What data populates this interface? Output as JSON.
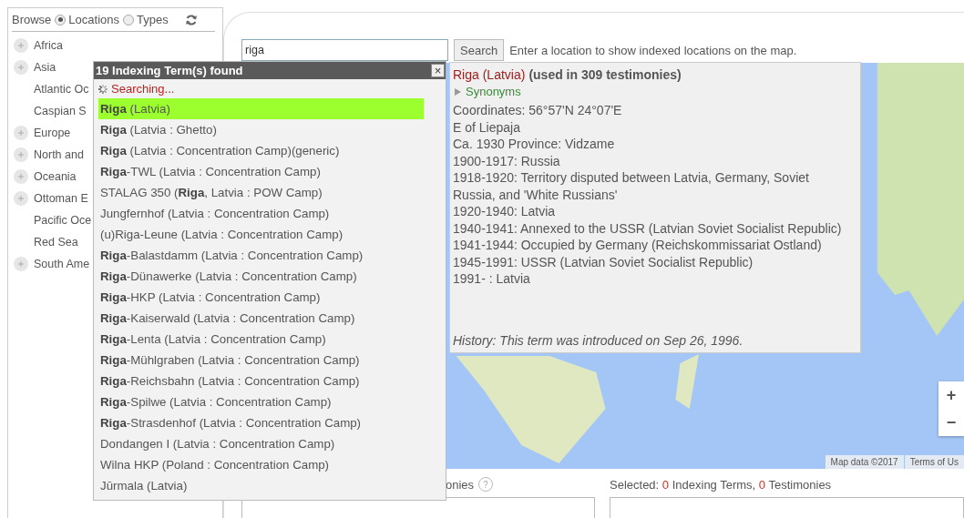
{
  "sidebar": {
    "browse_label": "Browse",
    "options": [
      {
        "label": "Locations",
        "selected": true
      },
      {
        "label": "Types",
        "selected": false
      }
    ],
    "tree": [
      {
        "label": "Africa",
        "expandable": true
      },
      {
        "label": "Asia",
        "expandable": true
      },
      {
        "label": "Atlantic Oc",
        "expandable": false
      },
      {
        "label": "Caspian S",
        "expandable": false
      },
      {
        "label": "Europe",
        "expandable": true
      },
      {
        "label": "North and",
        "expandable": true
      },
      {
        "label": "Oceania",
        "expandable": true
      },
      {
        "label": "Ottoman E",
        "expandable": true
      },
      {
        "label": "Pacific Oce",
        "expandable": false
      },
      {
        "label": "Red Sea",
        "expandable": false
      },
      {
        "label": "South Ame",
        "expandable": true
      }
    ]
  },
  "search": {
    "value": "riga",
    "button": "Search",
    "hint": "Enter a location to show indexed locations on the map."
  },
  "results": {
    "title": "19 Indexing Term(s) found",
    "close": "×",
    "status": "Searching...",
    "items": [
      {
        "text": "**Riga** (Latvia)",
        "selected": true
      },
      {
        "text": "**Riga** (Latvia : Ghetto)",
        "selected": false
      },
      {
        "text": "**Riga** (Latvia : Concentration Camp)(generic)",
        "selected": false
      },
      {
        "text": "**Riga**-TWL (Latvia : Concentration Camp)",
        "selected": false
      },
      {
        "text": "STALAG 350 (**Riga**, Latvia : POW Camp)",
        "selected": false
      },
      {
        "text": "Jungfernhof (Latvia : Concentration Camp)",
        "selected": false
      },
      {
        "text": "(u)Riga-Leune (Latvia : Concentration Camp)",
        "selected": false
      },
      {
        "text": "**Riga**-Balastdamm (Latvia : Concentration Camp)",
        "selected": false
      },
      {
        "text": "**Riga**-Dünawerke (Latvia : Concentration Camp)",
        "selected": false
      },
      {
        "text": "**Riga**-HKP (Latvia : Concentration Camp)",
        "selected": false
      },
      {
        "text": "**Riga**-Kaiserwald (Latvia : Concentration Camp)",
        "selected": false
      },
      {
        "text": "**Riga**-Lenta (Latvia : Concentration Camp)",
        "selected": false
      },
      {
        "text": "**Riga**-Mühlgraben (Latvia : Concentration Camp)",
        "selected": false
      },
      {
        "text": "**Riga**-Reichsbahn (Latvia : Concentration Camp)",
        "selected": false
      },
      {
        "text": "**Riga**-Spilwe (Latvia : Concentration Camp)",
        "selected": false
      },
      {
        "text": "**Riga**-Strasdenhof (Latvia : Concentration Camp)",
        "selected": false
      },
      {
        "text": "Dondangen I (Latvia : Concentration Camp)",
        "selected": false
      },
      {
        "text": "Wilna HKP (Poland : Concentration Camp)",
        "selected": false
      },
      {
        "text": "Jūrmala (Latvia)",
        "selected": false
      }
    ]
  },
  "details": {
    "term": "Riga (Latvia)",
    "usage": "(used in 309 testimonies)",
    "synonyms": "Synonyms",
    "expanded": false,
    "lines": [
      "Coordinates: 56°57'N 24°07'E",
      "E of Liepaja",
      "Ca. 1930 Province: Vidzame",
      "1900-1917: Russia",
      "1918-1920: Territory disputed between Latvia, Germany, Soviet Russia, and 'White Russians'",
      "1920-1940: Latvia",
      "1940-1941: Annexed to the USSR (Latvian Soviet Socialist Republic)",
      "1941-1944: Occupied by Germany (Reichskommissariat Ostland)",
      "1945-1991: USSR (Latvian Soviet Socialist Republic)",
      "1991- : Latvia"
    ],
    "history": "History: This term was introduced on Sep 26, 1996."
  },
  "map": {
    "zoom_in": "+",
    "zoom_out": "−",
    "attribution": "Map data ©2017",
    "terms": "Terms of Us"
  },
  "panels": {
    "testimonies_label": "onies",
    "help": "?",
    "selected": {
      "prefix": "Selected:",
      "terms_count": "0",
      "terms_label": "Indexing Terms,",
      "testimonies_count": "0",
      "testimonies_label": "Testimonies"
    }
  }
}
